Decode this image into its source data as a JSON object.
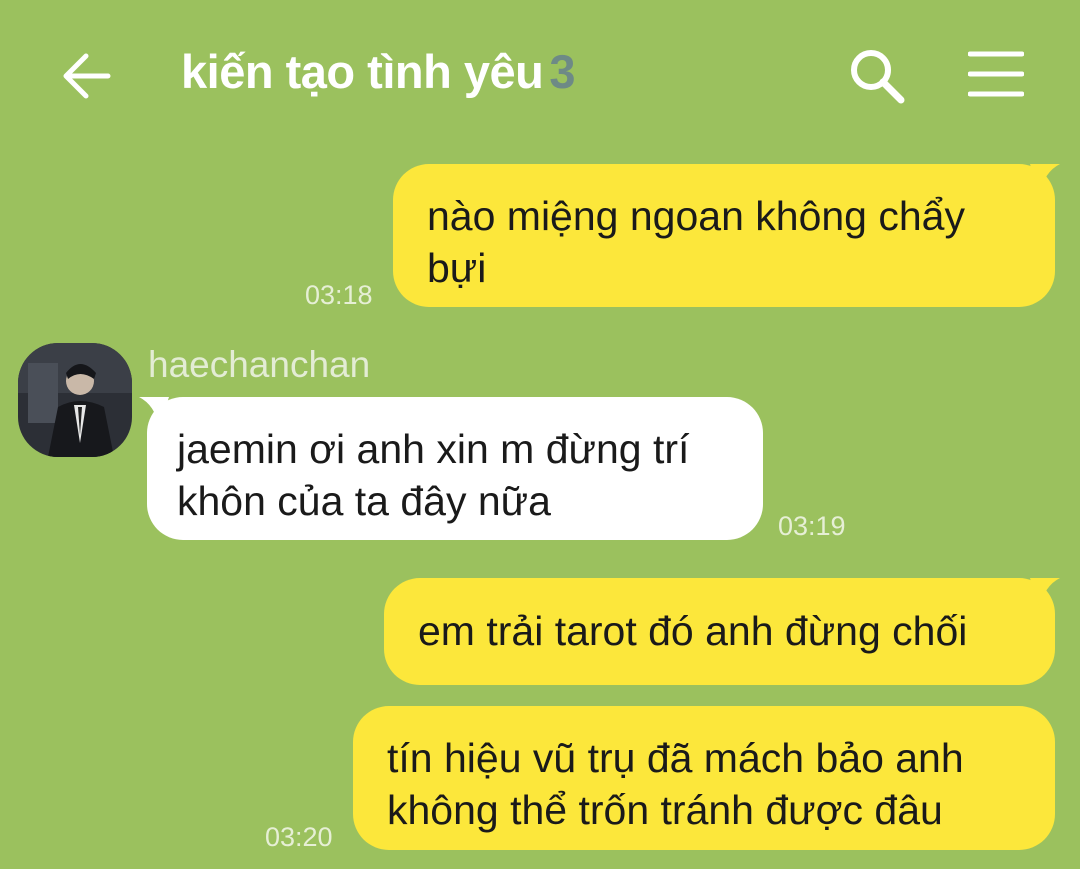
{
  "header": {
    "title": "kiến tạo tình yêu",
    "member_count": "3",
    "back_icon": "arrow-left-icon",
    "search_icon": "search-icon",
    "menu_icon": "hamburger-menu-icon"
  },
  "messages": [
    {
      "side": "me",
      "text_lines": [
        "nào miệng ngoan không chẩy",
        "bựi"
      ],
      "time": "03:18"
    },
    {
      "side": "them",
      "sender": "haechanchan",
      "text_lines": [
        "jaemin ơi anh xin m đừng trí",
        "khôn của ta đây nữa"
      ],
      "time": "03:19"
    },
    {
      "side": "me",
      "text_lines": [
        "em trải tarot đó anh đừng chối"
      ]
    },
    {
      "side": "me",
      "text_lines": [
        "tín hiệu vũ trụ đã mách bảo anh",
        "không thể trốn tránh được đâu"
      ],
      "time": "03:20"
    }
  ],
  "colors": {
    "background": "#9bc15e",
    "my_bubble": "#fce73b",
    "their_bubble": "#ffffff",
    "member_count": "#6e8a86"
  }
}
